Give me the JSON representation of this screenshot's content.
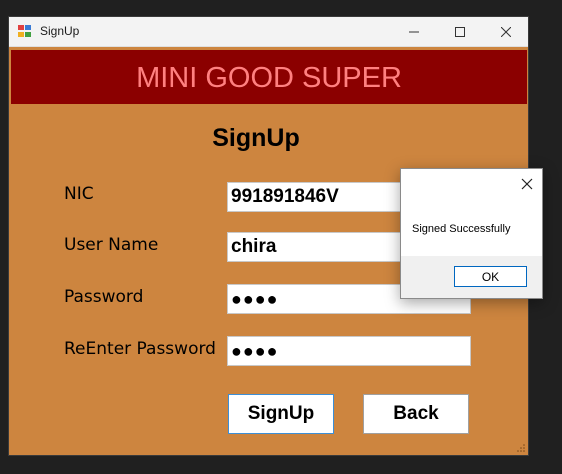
{
  "window": {
    "title": "SignUp"
  },
  "banner": {
    "text": "MINI GOOD SUPER"
  },
  "form": {
    "heading": "SignUp",
    "fields": [
      {
        "label": "NIC",
        "value": "991891846V"
      },
      {
        "label": "User Name",
        "value": "chira"
      },
      {
        "label": "Password",
        "value": "●●●●"
      },
      {
        "label": "ReEnter Password",
        "value": "●●●●"
      }
    ],
    "signup_label": "SignUp",
    "back_label": "Back"
  },
  "dialog": {
    "message": "Signed Successfully",
    "ok_label": "OK"
  },
  "colors": {
    "form_bg": "#cd853f",
    "banner_bg": "#8b0000",
    "banner_text": "#ff8080",
    "accent": "#0067c0"
  }
}
